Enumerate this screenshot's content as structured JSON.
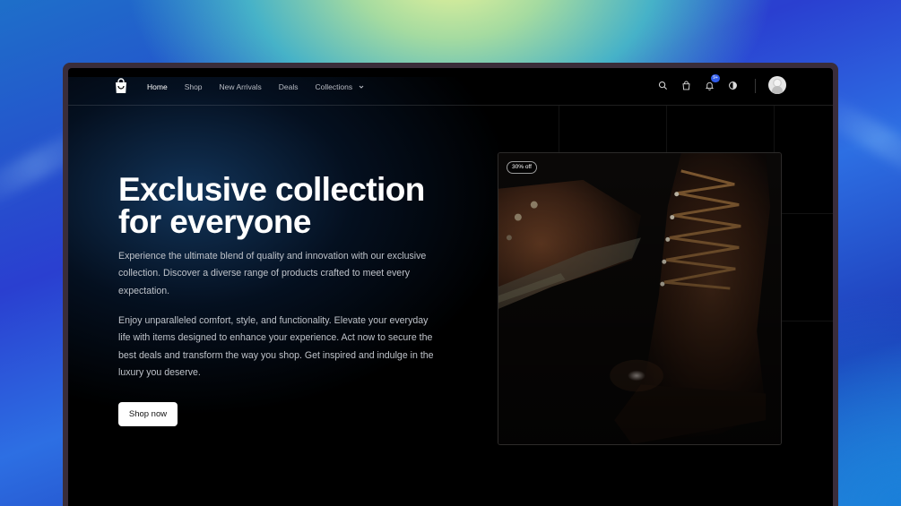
{
  "nav": {
    "links": [
      {
        "label": "Home",
        "active": true
      },
      {
        "label": "Shop",
        "active": false
      },
      {
        "label": "New Arrivals",
        "active": false
      },
      {
        "label": "Deals",
        "active": false
      },
      {
        "label": "Collections",
        "active": false,
        "has_dropdown": true
      }
    ],
    "icons": [
      "search-icon",
      "shopping-bag-icon",
      "bell-icon",
      "theme-toggle-icon"
    ],
    "notification_badge": "9+"
  },
  "hero": {
    "title_line1": "Exclusive collection",
    "title_line2": "for everyone",
    "paragraph1": "Experience the ultimate blend of quality and innovation with our exclusive collection. Discover a diverse range of products crafted to meet every expectation.",
    "paragraph2": "Enjoy unparalleled comfort, style, and functionality. Elevate your everyday life with items designed to enhance your experience. Act now to secure the best deals and transform the way you shop. Get inspired and indulge in the luxury you deserve.",
    "cta_label": "Shop now"
  },
  "product": {
    "discount_badge": "30% off",
    "image": "brown-leather-boot"
  },
  "colors": {
    "background": "#000000",
    "accent": "#2f5bea",
    "text_muted": "#bfc3ca",
    "button_bg": "#ffffff"
  }
}
